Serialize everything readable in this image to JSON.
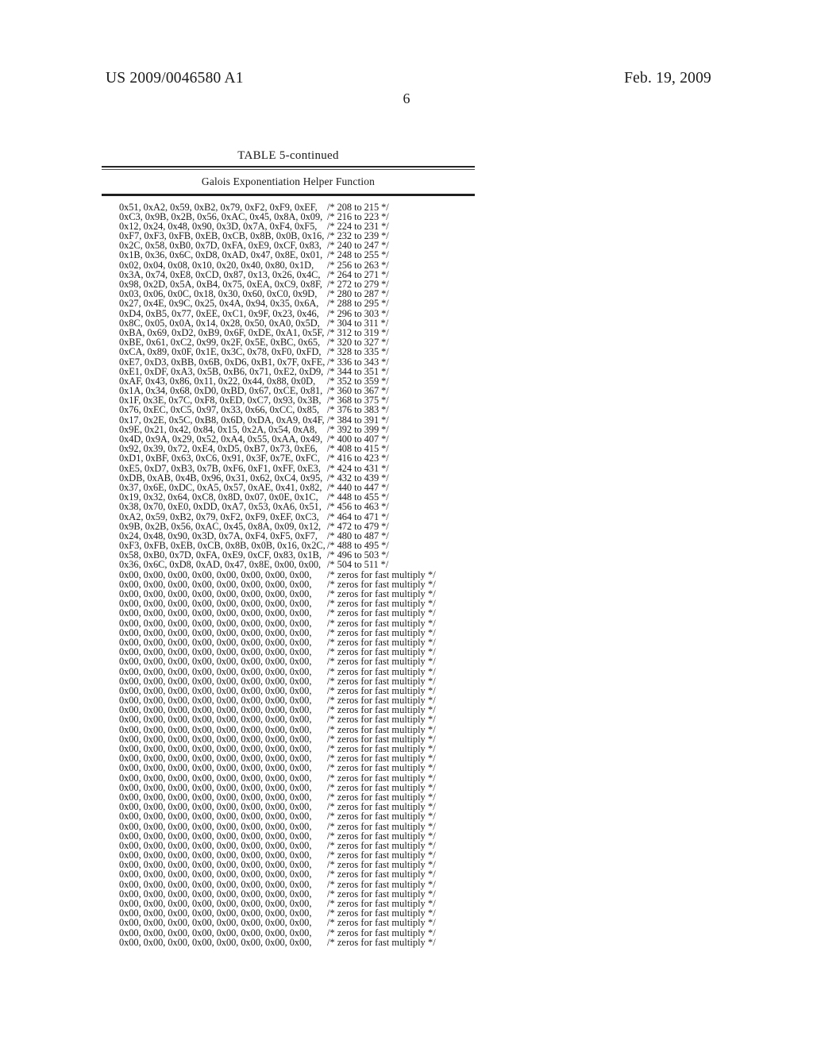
{
  "header": {
    "publication_number": "US 2009/0046580 A1",
    "publication_date": "Feb. 19, 2009",
    "page_number": "6"
  },
  "table": {
    "caption": "TABLE 5-continued",
    "subhead": "Galois Exponentiation Helper Function",
    "rows": [
      {
        "values": "0x51, 0xA2, 0x59, 0xB2, 0x79, 0xF2, 0xF9, 0xEF,",
        "comment": "/* 208 to 215 */"
      },
      {
        "values": "0xC3, 0x9B, 0x2B, 0x56, 0xAC, 0x45, 0x8A, 0x09,",
        "comment": "/* 216 to 223 */"
      },
      {
        "values": "0x12, 0x24, 0x48, 0x90, 0x3D, 0x7A, 0xF4, 0xF5,",
        "comment": "/* 224 to 231 */"
      },
      {
        "values": "0xF7, 0xF3, 0xFB, 0xEB, 0xCB, 0x8B, 0x0B, 0x16,",
        "comment": "/* 232 to 239 */"
      },
      {
        "values": "0x2C, 0x58, 0xB0, 0x7D, 0xFA, 0xE9, 0xCF, 0x83,",
        "comment": "/* 240 to 247 */"
      },
      {
        "values": "0x1B, 0x36, 0x6C, 0xD8, 0xAD, 0x47, 0x8E, 0x01,",
        "comment": "/* 248 to 255 */"
      },
      {
        "values": "0x02, 0x04, 0x08, 0x10, 0x20, 0x40, 0x80, 0x1D,",
        "comment": "/* 256 to 263 */"
      },
      {
        "values": "0x3A, 0x74, 0xE8, 0xCD, 0x87, 0x13, 0x26, 0x4C,",
        "comment": "/* 264 to 271 */"
      },
      {
        "values": "0x98, 0x2D, 0x5A, 0xB4, 0x75, 0xEA, 0xC9, 0x8F,",
        "comment": "/* 272 to 279 */"
      },
      {
        "values": "0x03, 0x06, 0x0C, 0x18, 0x30, 0x60, 0xC0, 0x9D,",
        "comment": "/* 280 to 287 */"
      },
      {
        "values": "0x27, 0x4E, 0x9C, 0x25, 0x4A, 0x94, 0x35, 0x6A,",
        "comment": "/* 288 to 295 */"
      },
      {
        "values": "0xD4, 0xB5, 0x77, 0xEE, 0xC1, 0x9F, 0x23, 0x46,",
        "comment": "/* 296 to 303 */"
      },
      {
        "values": "0x8C, 0x05, 0x0A, 0x14, 0x28, 0x50, 0xA0, 0x5D,",
        "comment": "/* 304 to 311 */"
      },
      {
        "values": "0xBA, 0x69, 0xD2, 0xB9, 0x6F, 0xDE, 0xA1, 0x5F,",
        "comment": "/* 312 to 319 */"
      },
      {
        "values": "0xBE, 0x61, 0xC2, 0x99, 0x2F, 0x5E, 0xBC, 0x65,",
        "comment": "/* 320 to 327 */"
      },
      {
        "values": "0xCA, 0x89, 0x0F, 0x1E, 0x3C, 0x78, 0xF0, 0xFD,",
        "comment": "/* 328 to 335 */"
      },
      {
        "values": "0xE7, 0xD3, 0xBB, 0x6B, 0xD6, 0xB1, 0x7F, 0xFE,",
        "comment": "/* 336 to 343 */"
      },
      {
        "values": "0xE1, 0xDF, 0xA3, 0x5B, 0xB6, 0x71, 0xE2, 0xD9,",
        "comment": "/* 344 to 351 */"
      },
      {
        "values": "0xAF, 0x43, 0x86, 0x11, 0x22, 0x44, 0x88, 0x0D,",
        "comment": "/* 352 to 359 */"
      },
      {
        "values": "0x1A, 0x34, 0x68, 0xD0, 0xBD, 0x67, 0xCE, 0x81,",
        "comment": "/* 360 to 367 */"
      },
      {
        "values": "0x1F, 0x3E, 0x7C, 0xF8, 0xED, 0xC7, 0x93, 0x3B,",
        "comment": "/* 368 to 375 */"
      },
      {
        "values": "0x76, 0xEC, 0xC5, 0x97, 0x33, 0x66, 0xCC, 0x85,",
        "comment": "/* 376 to 383 */"
      },
      {
        "values": "0x17, 0x2E, 0x5C, 0xB8, 0x6D, 0xDA, 0xA9, 0x4F,",
        "comment": "/* 384 to 391 */"
      },
      {
        "values": "0x9E, 0x21, 0x42, 0x84, 0x15, 0x2A, 0x54, 0xA8,",
        "comment": "/* 392 to 399 */"
      },
      {
        "values": "0x4D, 0x9A, 0x29, 0x52, 0xA4, 0x55, 0xAA, 0x49,",
        "comment": "/* 400 to 407 */"
      },
      {
        "values": "0x92, 0x39, 0x72, 0xE4, 0xD5, 0xB7, 0x73, 0xE6,",
        "comment": "/* 408 to 415 */"
      },
      {
        "values": "0xD1, 0xBF, 0x63, 0xC6, 0x91, 0x3F, 0x7E, 0xFC,",
        "comment": "/* 416 to 423 */"
      },
      {
        "values": "0xE5, 0xD7, 0xB3, 0x7B, 0xF6, 0xF1, 0xFF, 0xE3,",
        "comment": "/* 424 to 431 */"
      },
      {
        "values": "0xDB, 0xAB, 0x4B, 0x96, 0x31, 0x62, 0xC4, 0x95,",
        "comment": "/* 432 to 439 */"
      },
      {
        "values": "0x37, 0x6E, 0xDC, 0xA5, 0x57, 0xAE, 0x41, 0x82,",
        "comment": "/* 440 to 447 */"
      },
      {
        "values": "0x19, 0x32, 0x64, 0xC8, 0x8D, 0x07, 0x0E, 0x1C,",
        "comment": "/* 448 to 455 */"
      },
      {
        "values": "0x38, 0x70, 0xE0, 0xDD, 0xA7, 0x53, 0xA6, 0x51,",
        "comment": "/* 456 to 463 */"
      },
      {
        "values": "0xA2, 0x59, 0xB2, 0x79, 0xF2, 0xF9, 0xEF, 0xC3,",
        "comment": "/* 464 to 471 */"
      },
      {
        "values": "0x9B, 0x2B, 0x56, 0xAC, 0x45, 0x8A, 0x09, 0x12,",
        "comment": "/* 472 to 479 */"
      },
      {
        "values": "0x24, 0x48, 0x90, 0x3D, 0x7A, 0xF4, 0xF5, 0xF7,",
        "comment": "/* 480 to 487 */"
      },
      {
        "values": "0xF3, 0xFB, 0xEB, 0xCB, 0x8B, 0x0B, 0x16, 0x2C,",
        "comment": "/* 488 to 495 */"
      },
      {
        "values": "0x58, 0xB0, 0x7D, 0xFA, 0xE9, 0xCF, 0x83, 0x1B,",
        "comment": "/* 496 to 503 */"
      },
      {
        "values": "0x36, 0x6C, 0xD8, 0xAD, 0x47, 0x8E, 0x00, 0x00,",
        "comment": "/* 504 to 511 */"
      },
      {
        "values": "0x00, 0x00, 0x00, 0x00, 0x00, 0x00, 0x00, 0x00,",
        "comment": "/* zeros for fast multiply */"
      },
      {
        "values": "0x00, 0x00, 0x00, 0x00, 0x00, 0x00, 0x00, 0x00,",
        "comment": "/* zeros for fast multiply */"
      },
      {
        "values": "0x00, 0x00, 0x00, 0x00, 0x00, 0x00, 0x00, 0x00,",
        "comment": "/* zeros for fast multiply */"
      },
      {
        "values": "0x00, 0x00, 0x00, 0x00, 0x00, 0x00, 0x00, 0x00,",
        "comment": "/* zeros for fast multiply */"
      },
      {
        "values": "0x00, 0x00, 0x00, 0x00, 0x00, 0x00, 0x00, 0x00,",
        "comment": "/* zeros for fast multiply */"
      },
      {
        "values": "0x00, 0x00, 0x00, 0x00, 0x00, 0x00, 0x00, 0x00,",
        "comment": "/* zeros for fast multiply */"
      },
      {
        "values": "0x00, 0x00, 0x00, 0x00, 0x00, 0x00, 0x00, 0x00,",
        "comment": "/* zeros for fast multiply */"
      },
      {
        "values": "0x00, 0x00, 0x00, 0x00, 0x00, 0x00, 0x00, 0x00,",
        "comment": "/* zeros for fast multiply */"
      },
      {
        "values": "0x00, 0x00, 0x00, 0x00, 0x00, 0x00, 0x00, 0x00,",
        "comment": "/* zeros for fast multiply */"
      },
      {
        "values": "0x00, 0x00, 0x00, 0x00, 0x00, 0x00, 0x00, 0x00,",
        "comment": "/* zeros for fast multiply */"
      },
      {
        "values": "0x00, 0x00, 0x00, 0x00, 0x00, 0x00, 0x00, 0x00,",
        "comment": "/* zeros for fast multiply */"
      },
      {
        "values": "0x00, 0x00, 0x00, 0x00, 0x00, 0x00, 0x00, 0x00,",
        "comment": "/* zeros for fast multiply */"
      },
      {
        "values": "0x00, 0x00, 0x00, 0x00, 0x00, 0x00, 0x00, 0x00,",
        "comment": "/* zeros for fast multiply */"
      },
      {
        "values": "0x00, 0x00, 0x00, 0x00, 0x00, 0x00, 0x00, 0x00,",
        "comment": "/* zeros for fast multiply */"
      },
      {
        "values": "0x00, 0x00, 0x00, 0x00, 0x00, 0x00, 0x00, 0x00,",
        "comment": "/* zeros for fast multiply */"
      },
      {
        "values": "0x00, 0x00, 0x00, 0x00, 0x00, 0x00, 0x00, 0x00,",
        "comment": "/* zeros for fast multiply */"
      },
      {
        "values": "0x00, 0x00, 0x00, 0x00, 0x00, 0x00, 0x00, 0x00,",
        "comment": "/* zeros for fast multiply */"
      },
      {
        "values": "0x00, 0x00, 0x00, 0x00, 0x00, 0x00, 0x00, 0x00,",
        "comment": "/* zeros for fast multiply */"
      },
      {
        "values": "0x00, 0x00, 0x00, 0x00, 0x00, 0x00, 0x00, 0x00,",
        "comment": "/* zeros for fast multiply */"
      },
      {
        "values": "0x00, 0x00, 0x00, 0x00, 0x00, 0x00, 0x00, 0x00,",
        "comment": "/* zeros for fast multiply */"
      },
      {
        "values": "0x00, 0x00, 0x00, 0x00, 0x00, 0x00, 0x00, 0x00,",
        "comment": "/* zeros for fast multiply */"
      },
      {
        "values": "0x00, 0x00, 0x00, 0x00, 0x00, 0x00, 0x00, 0x00,",
        "comment": "/* zeros for fast multiply */"
      },
      {
        "values": "0x00, 0x00, 0x00, 0x00, 0x00, 0x00, 0x00, 0x00,",
        "comment": "/* zeros for fast multiply */"
      },
      {
        "values": "0x00, 0x00, 0x00, 0x00, 0x00, 0x00, 0x00, 0x00,",
        "comment": "/* zeros for fast multiply */"
      },
      {
        "values": "0x00, 0x00, 0x00, 0x00, 0x00, 0x00, 0x00, 0x00,",
        "comment": "/* zeros for fast multiply */"
      },
      {
        "values": "0x00, 0x00, 0x00, 0x00, 0x00, 0x00, 0x00, 0x00,",
        "comment": "/* zeros for fast multiply */"
      },
      {
        "values": "0x00, 0x00, 0x00, 0x00, 0x00, 0x00, 0x00, 0x00,",
        "comment": "/* zeros for fast multiply */"
      },
      {
        "values": "0x00, 0x00, 0x00, 0x00, 0x00, 0x00, 0x00, 0x00,",
        "comment": "/* zeros for fast multiply */"
      },
      {
        "values": "0x00, 0x00, 0x00, 0x00, 0x00, 0x00, 0x00, 0x00,",
        "comment": "/* zeros for fast multiply */"
      },
      {
        "values": "0x00, 0x00, 0x00, 0x00, 0x00, 0x00, 0x00, 0x00,",
        "comment": "/* zeros for fast multiply */"
      },
      {
        "values": "0x00, 0x00, 0x00, 0x00, 0x00, 0x00, 0x00, 0x00,",
        "comment": "/* zeros for fast multiply */"
      },
      {
        "values": "0x00, 0x00, 0x00, 0x00, 0x00, 0x00, 0x00, 0x00,",
        "comment": "/* zeros for fast multiply */"
      },
      {
        "values": "0x00, 0x00, 0x00, 0x00, 0x00, 0x00, 0x00, 0x00,",
        "comment": "/* zeros for fast multiply */"
      },
      {
        "values": "0x00, 0x00, 0x00, 0x00, 0x00, 0x00, 0x00, 0x00,",
        "comment": "/* zeros for fast multiply */"
      },
      {
        "values": "0x00, 0x00, 0x00, 0x00, 0x00, 0x00, 0x00, 0x00,",
        "comment": "/* zeros for fast multiply */"
      },
      {
        "values": "0x00, 0x00, 0x00, 0x00, 0x00, 0x00, 0x00, 0x00,",
        "comment": "/* zeros for fast multiply */"
      },
      {
        "values": "0x00, 0x00, 0x00, 0x00, 0x00, 0x00, 0x00, 0x00,",
        "comment": "/* zeros for fast multiply */"
      },
      {
        "values": "0x00, 0x00, 0x00, 0x00, 0x00, 0x00, 0x00, 0x00,",
        "comment": "/* zeros for fast multiply */"
      },
      {
        "values": "0x00, 0x00, 0x00, 0x00, 0x00, 0x00, 0x00, 0x00,",
        "comment": "/* zeros for fast multiply */"
      }
    ]
  }
}
